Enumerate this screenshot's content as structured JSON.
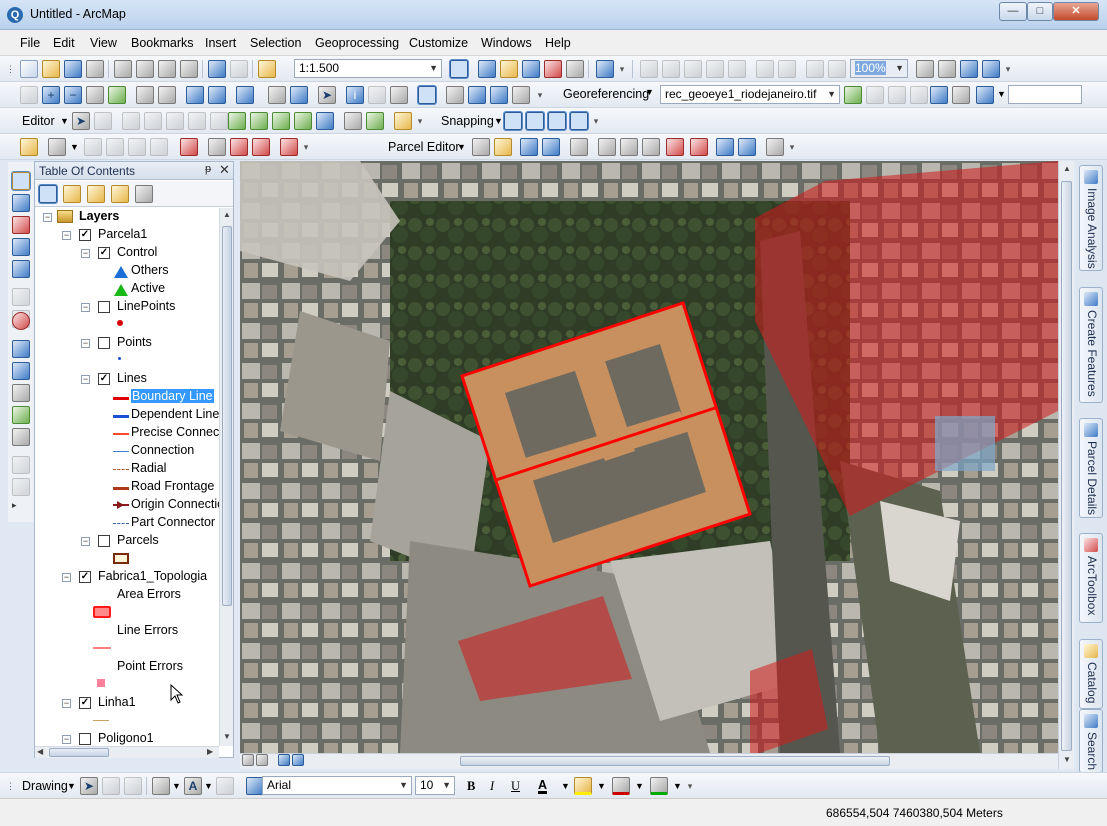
{
  "window": {
    "title": "Untitled - ArcMap",
    "app_icon_glyph": "Q",
    "controls": {
      "minimize": "—",
      "maximize": "□",
      "close": "✕"
    }
  },
  "menu": [
    "File",
    "Edit",
    "View",
    "Bookmarks",
    "Insert",
    "Selection",
    "Geoprocessing",
    "Customize",
    "Windows",
    "Help"
  ],
  "toolbar1": {
    "scale": "1:1.500",
    "zoom_percent": "100%"
  },
  "toolbar2": {
    "georeferencing_label": "Georeferencing",
    "raster_layer": "rec_geoeye1_riodejaneiro.tif"
  },
  "toolbar3": {
    "editor_label": "Editor",
    "snapping_label": "Snapping"
  },
  "toolbar4": {
    "parcel_editor_label": "Parcel Editor"
  },
  "toc": {
    "title": "Table Of Contents",
    "pin_glyph": "ᵽ",
    "close_glyph": "✕",
    "layers_root": "Layers",
    "items": {
      "parcela1": "Parcela1",
      "control": "Control",
      "others": "Others",
      "active": "Active",
      "linepoints": "LinePoints",
      "points": "Points",
      "lines": "Lines",
      "boundary_line": "Boundary Line",
      "dependent_line": "Dependent Line",
      "precise_connection": "Precise Connection",
      "connection": "Connection",
      "radial": "Radial",
      "road_frontage": "Road Frontage",
      "origin_connection": "Origin Connection",
      "part_connector": "Part Connector",
      "parcels": "Parcels",
      "fabrica1_topologia": "Fabrica1_Topologia",
      "area_errors": "Area Errors",
      "line_errors": "Line Errors",
      "point_errors": "Point Errors",
      "linha1": "Linha1",
      "poligono1": "Poligono1"
    },
    "symbol_colors": {
      "others": "#1a6fd6",
      "active": "#18b818",
      "linepoints": "#d40000",
      "points": "#1a4fd6",
      "boundary_line": "#e00000",
      "dependent_line": "#1a4fd6",
      "precise_connection": "#ff4a2a",
      "connection": "#3a7fd6",
      "radial": "#b05030",
      "road_frontage": "#b0381a",
      "origin_connection": "#8a1a1a",
      "part_connector": "#3a5fb0",
      "parcels_fill": "#fff6d9",
      "parcels_stroke": "#7a2a0a",
      "area_errors": "#ff1a1a",
      "line_errors": "#ff7f7f",
      "point_errors": "#ff7f9a",
      "linha1": "#c8a060",
      "poligono1": "#cccccc"
    },
    "checkbox_states": {
      "parcela1": true,
      "control": true,
      "linepoints": false,
      "points": false,
      "lines": true,
      "parcels": false,
      "fabrica1_topologia": true,
      "linha1": true,
      "poligono1": false
    }
  },
  "dock_tabs": [
    "Image Analysis",
    "Create Features",
    "Parcel Details",
    "ArcToolbox",
    "Catalog",
    "Search"
  ],
  "drawing_toolbar": {
    "drawing_label": "Drawing",
    "font": "Arial",
    "font_size": "10",
    "bold": "B",
    "italic": "I",
    "underline": "U",
    "font_color_glyph": "A",
    "fill_color": "#ffee00",
    "line_color": "#cc0000",
    "marker_color": "#00aa00"
  },
  "status": {
    "coordinates": "686554,504  7460380,504 Meters"
  },
  "map_colors": {
    "parcel_outline": "#ff0000",
    "selection_fill": "#d41a1a",
    "imagery_base": "#4b5546"
  }
}
